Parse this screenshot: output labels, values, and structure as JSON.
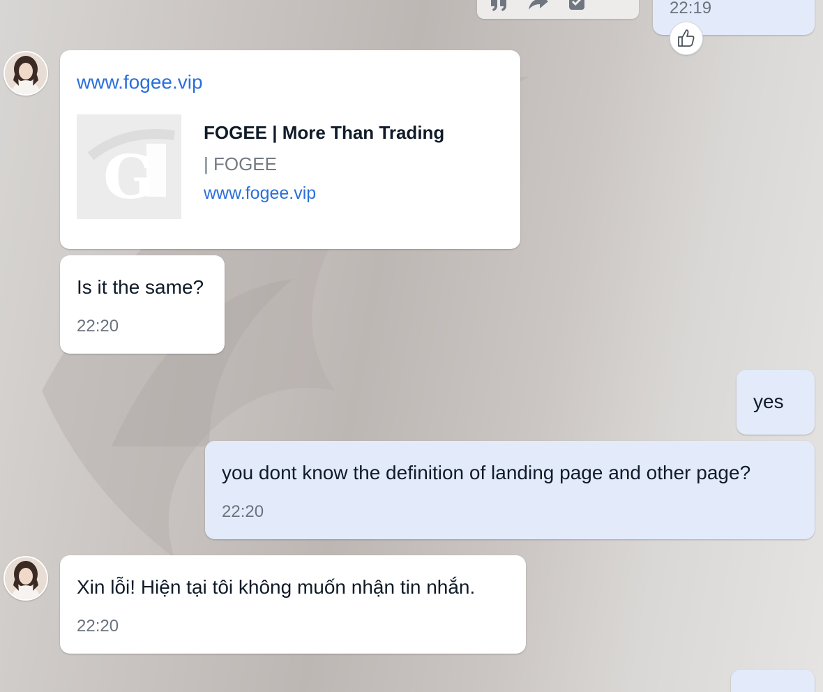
{
  "toolbar": {
    "icons": [
      "quote-icon",
      "forward-icon",
      "checkbox-icon",
      "more-icon"
    ]
  },
  "messages": [
    {
      "side": "outgoing",
      "time": "22:19",
      "reaction": "thumbs-up-icon"
    },
    {
      "side": "incoming",
      "link": "www.fogee.vip",
      "preview": {
        "title": "FOGEE | More Than Trading",
        "description": "| FOGEE",
        "domain": "www.fogee.vip",
        "thumb_icon": "fogee-logo"
      }
    },
    {
      "side": "incoming",
      "text": "Is it the same?",
      "time": "22:20"
    },
    {
      "side": "outgoing",
      "text": "yes"
    },
    {
      "side": "outgoing",
      "text": "you dont know the definition of landing page and other page?",
      "time": "22:20"
    },
    {
      "side": "incoming",
      "text": "Xin lỗi! Hiện tại tôi không muốn nhận tin nhắn.",
      "time": "22:20"
    }
  ],
  "colors": {
    "incoming_bubble": "#ffffff",
    "outgoing_bubble": "#e3ebfb",
    "link": "#2a6fdc",
    "timestamp": "#6a737c"
  }
}
